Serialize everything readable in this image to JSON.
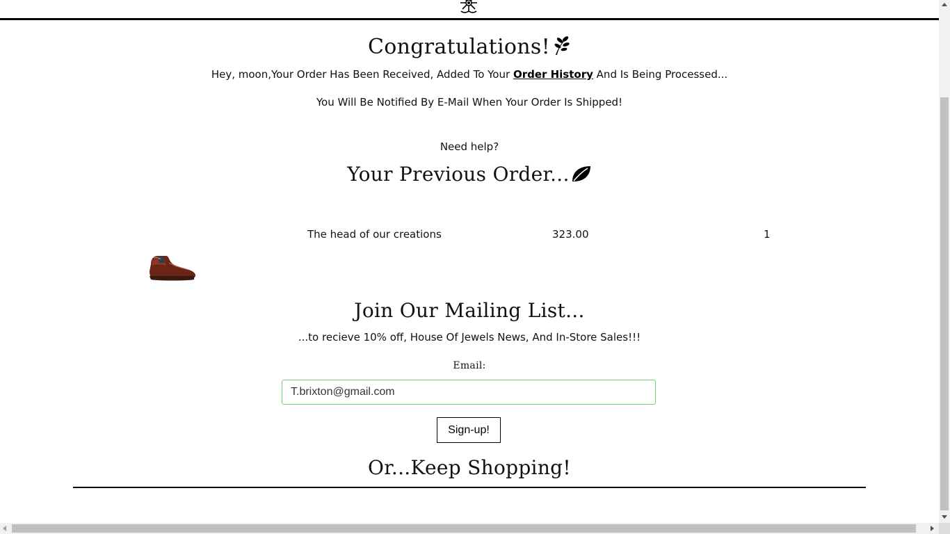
{
  "confirmation": {
    "title": "Congratulations!",
    "greeting_prefix": "Hey, moon,Your Order Has Been Received, Added To Your ",
    "order_history_link": "Order History",
    "greeting_suffix": " And Is Being Processed...",
    "notice": "You Will Be Notified By E-Mail When Your Order Is Shipped!",
    "help": "Need help?"
  },
  "previous_order": {
    "title": "Your Previous Order...",
    "items": [
      {
        "name": "The head of our creations",
        "price": "323.00",
        "quantity": "1",
        "image_icon": "brown-leather-boot-icon"
      }
    ]
  },
  "mailing_list": {
    "title": "Join Our Mailing List...",
    "subtitle": "...to recieve 10% off, House Of Jewels News, And In-Store Sales!!!",
    "email_label": "Email:",
    "email_value": "T.brixton@gmail.com",
    "signup_label": "Sign-up!"
  },
  "footer": {
    "title": "Or...Keep Shopping!"
  },
  "colors": {
    "input_border": "#6fd27a",
    "text": "#111111",
    "rule": "#000000"
  },
  "icons": {
    "logo": "flower-logo-icon",
    "title_icon": "leaf-sprig-icon",
    "order_icon": "leaf-icon"
  }
}
